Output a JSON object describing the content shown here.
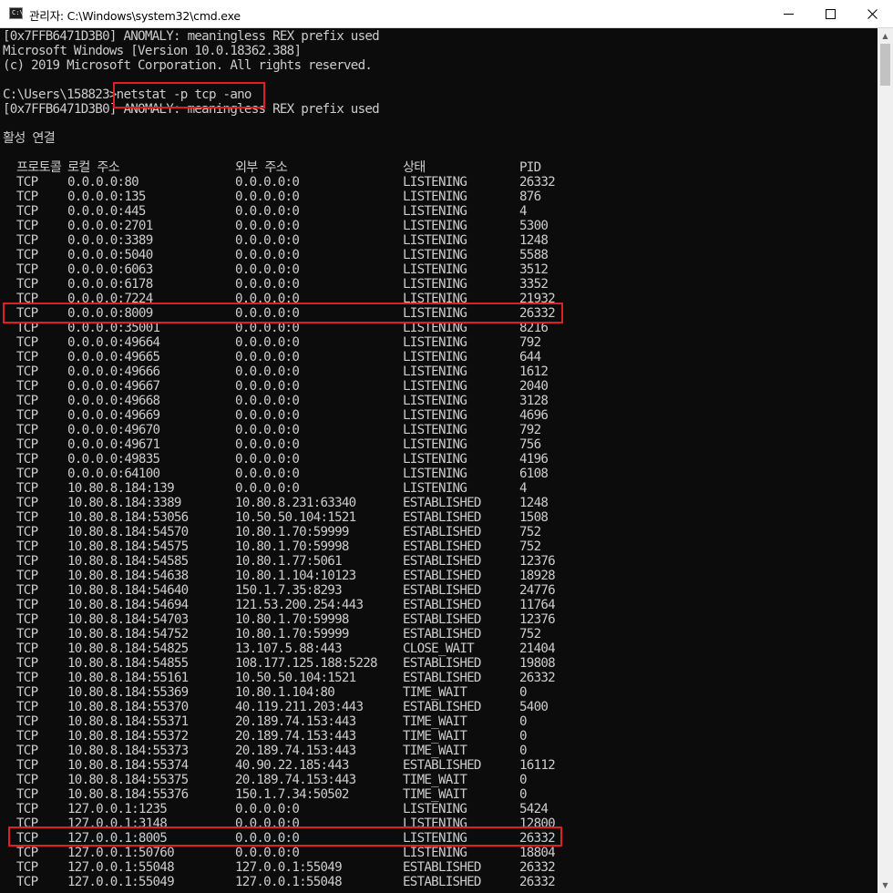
{
  "window": {
    "icon_label": "C:\\",
    "title": "관리자: C:\\Windows\\system32\\cmd.exe",
    "minimize_glyph": "─",
    "maximize_glyph": "☐",
    "close_glyph": "✕"
  },
  "console": {
    "lines": [
      "[0x7FFB6471D3B0] ANOMALY: meaningless REX prefix used",
      "Microsoft Windows [Version 10.0.18362.388]",
      "(c) 2019 Microsoft Corporation. All rights reserved.",
      "",
      "C:\\Users\\158823>netstat -p tcp -ano",
      "[0x7FFB6471D3B0] ANOMALY: meaningless REX prefix used",
      "",
      "활성 연결",
      ""
    ],
    "table_header": {
      "proto": "프로토콜",
      "local": "로컬 주소",
      "foreign": "외부 주소",
      "state": "상태",
      "pid": "PID"
    },
    "rows": [
      {
        "proto": "TCP",
        "local": "0.0.0.0:80",
        "foreign": "0.0.0.0:0",
        "state": "LISTENING",
        "pid": "26332"
      },
      {
        "proto": "TCP",
        "local": "0.0.0.0:135",
        "foreign": "0.0.0.0:0",
        "state": "LISTENING",
        "pid": "876"
      },
      {
        "proto": "TCP",
        "local": "0.0.0.0:445",
        "foreign": "0.0.0.0:0",
        "state": "LISTENING",
        "pid": "4"
      },
      {
        "proto": "TCP",
        "local": "0.0.0.0:2701",
        "foreign": "0.0.0.0:0",
        "state": "LISTENING",
        "pid": "5300"
      },
      {
        "proto": "TCP",
        "local": "0.0.0.0:3389",
        "foreign": "0.0.0.0:0",
        "state": "LISTENING",
        "pid": "1248"
      },
      {
        "proto": "TCP",
        "local": "0.0.0.0:5040",
        "foreign": "0.0.0.0:0",
        "state": "LISTENING",
        "pid": "5588"
      },
      {
        "proto": "TCP",
        "local": "0.0.0.0:6063",
        "foreign": "0.0.0.0:0",
        "state": "LISTENING",
        "pid": "3512"
      },
      {
        "proto": "TCP",
        "local": "0.0.0.0:6178",
        "foreign": "0.0.0.0:0",
        "state": "LISTENING",
        "pid": "3352"
      },
      {
        "proto": "TCP",
        "local": "0.0.0.0:7224",
        "foreign": "0.0.0.0:0",
        "state": "LISTENING",
        "pid": "21932"
      },
      {
        "proto": "TCP",
        "local": "0.0.0.0:8009",
        "foreign": "0.0.0.0:0",
        "state": "LISTENING",
        "pid": "26332"
      },
      {
        "proto": "TCP",
        "local": "0.0.0.0:35001",
        "foreign": "0.0.0.0:0",
        "state": "LISTENING",
        "pid": "8216"
      },
      {
        "proto": "TCP",
        "local": "0.0.0.0:49664",
        "foreign": "0.0.0.0:0",
        "state": "LISTENING",
        "pid": "792"
      },
      {
        "proto": "TCP",
        "local": "0.0.0.0:49665",
        "foreign": "0.0.0.0:0",
        "state": "LISTENING",
        "pid": "644"
      },
      {
        "proto": "TCP",
        "local": "0.0.0.0:49666",
        "foreign": "0.0.0.0:0",
        "state": "LISTENING",
        "pid": "1612"
      },
      {
        "proto": "TCP",
        "local": "0.0.0.0:49667",
        "foreign": "0.0.0.0:0",
        "state": "LISTENING",
        "pid": "2040"
      },
      {
        "proto": "TCP",
        "local": "0.0.0.0:49668",
        "foreign": "0.0.0.0:0",
        "state": "LISTENING",
        "pid": "3128"
      },
      {
        "proto": "TCP",
        "local": "0.0.0.0:49669",
        "foreign": "0.0.0.0:0",
        "state": "LISTENING",
        "pid": "4696"
      },
      {
        "proto": "TCP",
        "local": "0.0.0.0:49670",
        "foreign": "0.0.0.0:0",
        "state": "LISTENING",
        "pid": "792"
      },
      {
        "proto": "TCP",
        "local": "0.0.0.0:49671",
        "foreign": "0.0.0.0:0",
        "state": "LISTENING",
        "pid": "756"
      },
      {
        "proto": "TCP",
        "local": "0.0.0.0:49835",
        "foreign": "0.0.0.0:0",
        "state": "LISTENING",
        "pid": "4196"
      },
      {
        "proto": "TCP",
        "local": "0.0.0.0:64100",
        "foreign": "0.0.0.0:0",
        "state": "LISTENING",
        "pid": "6108"
      },
      {
        "proto": "TCP",
        "local": "10.80.8.184:139",
        "foreign": "0.0.0.0:0",
        "state": "LISTENING",
        "pid": "4"
      },
      {
        "proto": "TCP",
        "local": "10.80.8.184:3389",
        "foreign": "10.80.8.231:63340",
        "state": "ESTABLISHED",
        "pid": "1248"
      },
      {
        "proto": "TCP",
        "local": "10.80.8.184:53056",
        "foreign": "10.50.50.104:1521",
        "state": "ESTABLISHED",
        "pid": "1508"
      },
      {
        "proto": "TCP",
        "local": "10.80.8.184:54570",
        "foreign": "10.80.1.70:59999",
        "state": "ESTABLISHED",
        "pid": "752"
      },
      {
        "proto": "TCP",
        "local": "10.80.8.184:54575",
        "foreign": "10.80.1.70:59998",
        "state": "ESTABLISHED",
        "pid": "752"
      },
      {
        "proto": "TCP",
        "local": "10.80.8.184:54585",
        "foreign": "10.80.1.77:5061",
        "state": "ESTABLISHED",
        "pid": "12376"
      },
      {
        "proto": "TCP",
        "local": "10.80.8.184:54638",
        "foreign": "10.80.1.104:10123",
        "state": "ESTABLISHED",
        "pid": "18928"
      },
      {
        "proto": "TCP",
        "local": "10.80.8.184:54640",
        "foreign": "150.1.7.35:8293",
        "state": "ESTABLISHED",
        "pid": "24776"
      },
      {
        "proto": "TCP",
        "local": "10.80.8.184:54694",
        "foreign": "121.53.200.254:443",
        "state": "ESTABLISHED",
        "pid": "11764"
      },
      {
        "proto": "TCP",
        "local": "10.80.8.184:54703",
        "foreign": "10.80.1.70:59998",
        "state": "ESTABLISHED",
        "pid": "12376"
      },
      {
        "proto": "TCP",
        "local": "10.80.8.184:54752",
        "foreign": "10.80.1.70:59999",
        "state": "ESTABLISHED",
        "pid": "752"
      },
      {
        "proto": "TCP",
        "local": "10.80.8.184:54825",
        "foreign": "13.107.5.88:443",
        "state": "CLOSE_WAIT",
        "pid": "21404"
      },
      {
        "proto": "TCP",
        "local": "10.80.8.184:54855",
        "foreign": "108.177.125.188:5228",
        "state": "ESTABLISHED",
        "pid": "19808"
      },
      {
        "proto": "TCP",
        "local": "10.80.8.184:55161",
        "foreign": "10.50.50.104:1521",
        "state": "ESTABLISHED",
        "pid": "26332"
      },
      {
        "proto": "TCP",
        "local": "10.80.8.184:55369",
        "foreign": "10.80.1.104:80",
        "state": "TIME_WAIT",
        "pid": "0"
      },
      {
        "proto": "TCP",
        "local": "10.80.8.184:55370",
        "foreign": "40.119.211.203:443",
        "state": "ESTABLISHED",
        "pid": "5400"
      },
      {
        "proto": "TCP",
        "local": "10.80.8.184:55371",
        "foreign": "20.189.74.153:443",
        "state": "TIME_WAIT",
        "pid": "0"
      },
      {
        "proto": "TCP",
        "local": "10.80.8.184:55372",
        "foreign": "20.189.74.153:443",
        "state": "TIME_WAIT",
        "pid": "0"
      },
      {
        "proto": "TCP",
        "local": "10.80.8.184:55373",
        "foreign": "20.189.74.153:443",
        "state": "TIME_WAIT",
        "pid": "0"
      },
      {
        "proto": "TCP",
        "local": "10.80.8.184:55374",
        "foreign": "40.90.22.185:443",
        "state": "ESTABLISHED",
        "pid": "16112"
      },
      {
        "proto": "TCP",
        "local": "10.80.8.184:55375",
        "foreign": "20.189.74.153:443",
        "state": "TIME_WAIT",
        "pid": "0"
      },
      {
        "proto": "TCP",
        "local": "10.80.8.184:55376",
        "foreign": "150.1.7.34:50502",
        "state": "TIME_WAIT",
        "pid": "0"
      },
      {
        "proto": "TCP",
        "local": "127.0.0.1:1235",
        "foreign": "0.0.0.0:0",
        "state": "LISTENING",
        "pid": "5424"
      },
      {
        "proto": "TCP",
        "local": "127.0.0.1:3148",
        "foreign": "0.0.0.0:0",
        "state": "LISTENING",
        "pid": "12800"
      },
      {
        "proto": "TCP",
        "local": "127.0.0.1:8005",
        "foreign": "0.0.0.0:0",
        "state": "LISTENING",
        "pid": "26332"
      },
      {
        "proto": "TCP",
        "local": "127.0.0.1:50760",
        "foreign": "0.0.0.0:0",
        "state": "LISTENING",
        "pid": "18804"
      },
      {
        "proto": "TCP",
        "local": "127.0.0.1:55048",
        "foreign": "127.0.0.1:55049",
        "state": "ESTABLISHED",
        "pid": "26332"
      },
      {
        "proto": "TCP",
        "local": "127.0.0.1:55049",
        "foreign": "127.0.0.1:55048",
        "state": "ESTABLISHED",
        "pid": "26332"
      }
    ]
  },
  "colors": {
    "background": "#0c0c0c",
    "text": "#cccccc",
    "highlight": "#e02020"
  },
  "scrollbar": {
    "up_glyph": "▲",
    "down_glyph": "▼"
  }
}
